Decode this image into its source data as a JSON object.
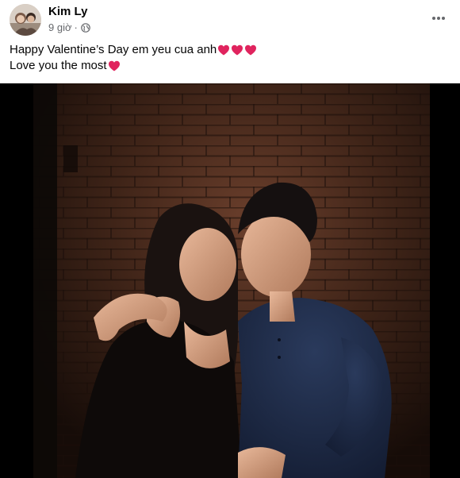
{
  "post": {
    "author": "Kim Ly",
    "time": "9 giờ",
    "separator": "·",
    "privacy_icon": "globe-icon",
    "more_icon": "more-horizontal-icon",
    "caption_line1": "Happy Valentine’s Day em yeu cua anh",
    "caption_line1_hearts": 3,
    "caption_line2": "Love you the most",
    "caption_line2_hearts": 1,
    "heart_color": "#e0245e"
  },
  "photo": {
    "alt": "Couple photo against brick wall"
  }
}
